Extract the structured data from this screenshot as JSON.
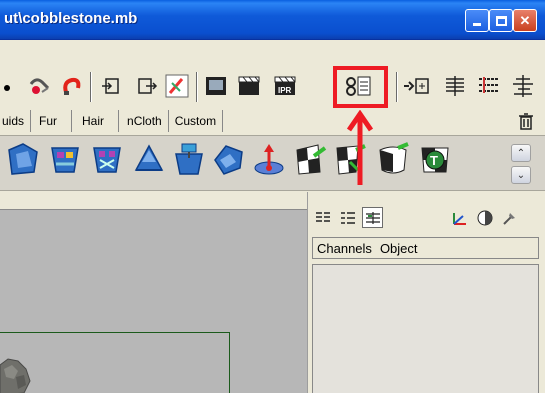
{
  "window": {
    "title": "ut\\cobblestone.mb",
    "buttons": [
      "minimize",
      "maximize",
      "close"
    ]
  },
  "toolbar_icons": [
    "lasso-dot-icon",
    "paint-select-icon",
    "magnet-icon",
    "input-icon",
    "output-icon",
    "history-icon",
    "render-frame-icon",
    "render-sequence-icon",
    "ipr-render-icon",
    "render-settings-icon",
    "snap-icon",
    "hypershade-icon",
    "outliner-icon",
    "attribute-icon"
  ],
  "shelf_tabs": [
    {
      "label": "uids"
    },
    {
      "label": "Fur"
    },
    {
      "label": "Hair"
    },
    {
      "label": "nCloth"
    },
    {
      "label": "Custom"
    }
  ],
  "shelf_icons": [
    "ncloth-a-icon",
    "ncloth-b-icon",
    "ncloth-c-icon",
    "ncloth-d-icon",
    "ncloth-e-icon",
    "ncloth-f-icon",
    "field-icon",
    "uv-checker-icon",
    "uv-layout-icon",
    "uv-edit-icon",
    "uv-texture-icon"
  ],
  "channel_box": {
    "menu": [
      "Channels",
      "Object"
    ]
  },
  "colors": {
    "titlebar": "#0f5ad9",
    "annotation": "#ee1b24",
    "viewport_bg": "#b7b7b7",
    "frame_line": "#1b5a1b"
  }
}
